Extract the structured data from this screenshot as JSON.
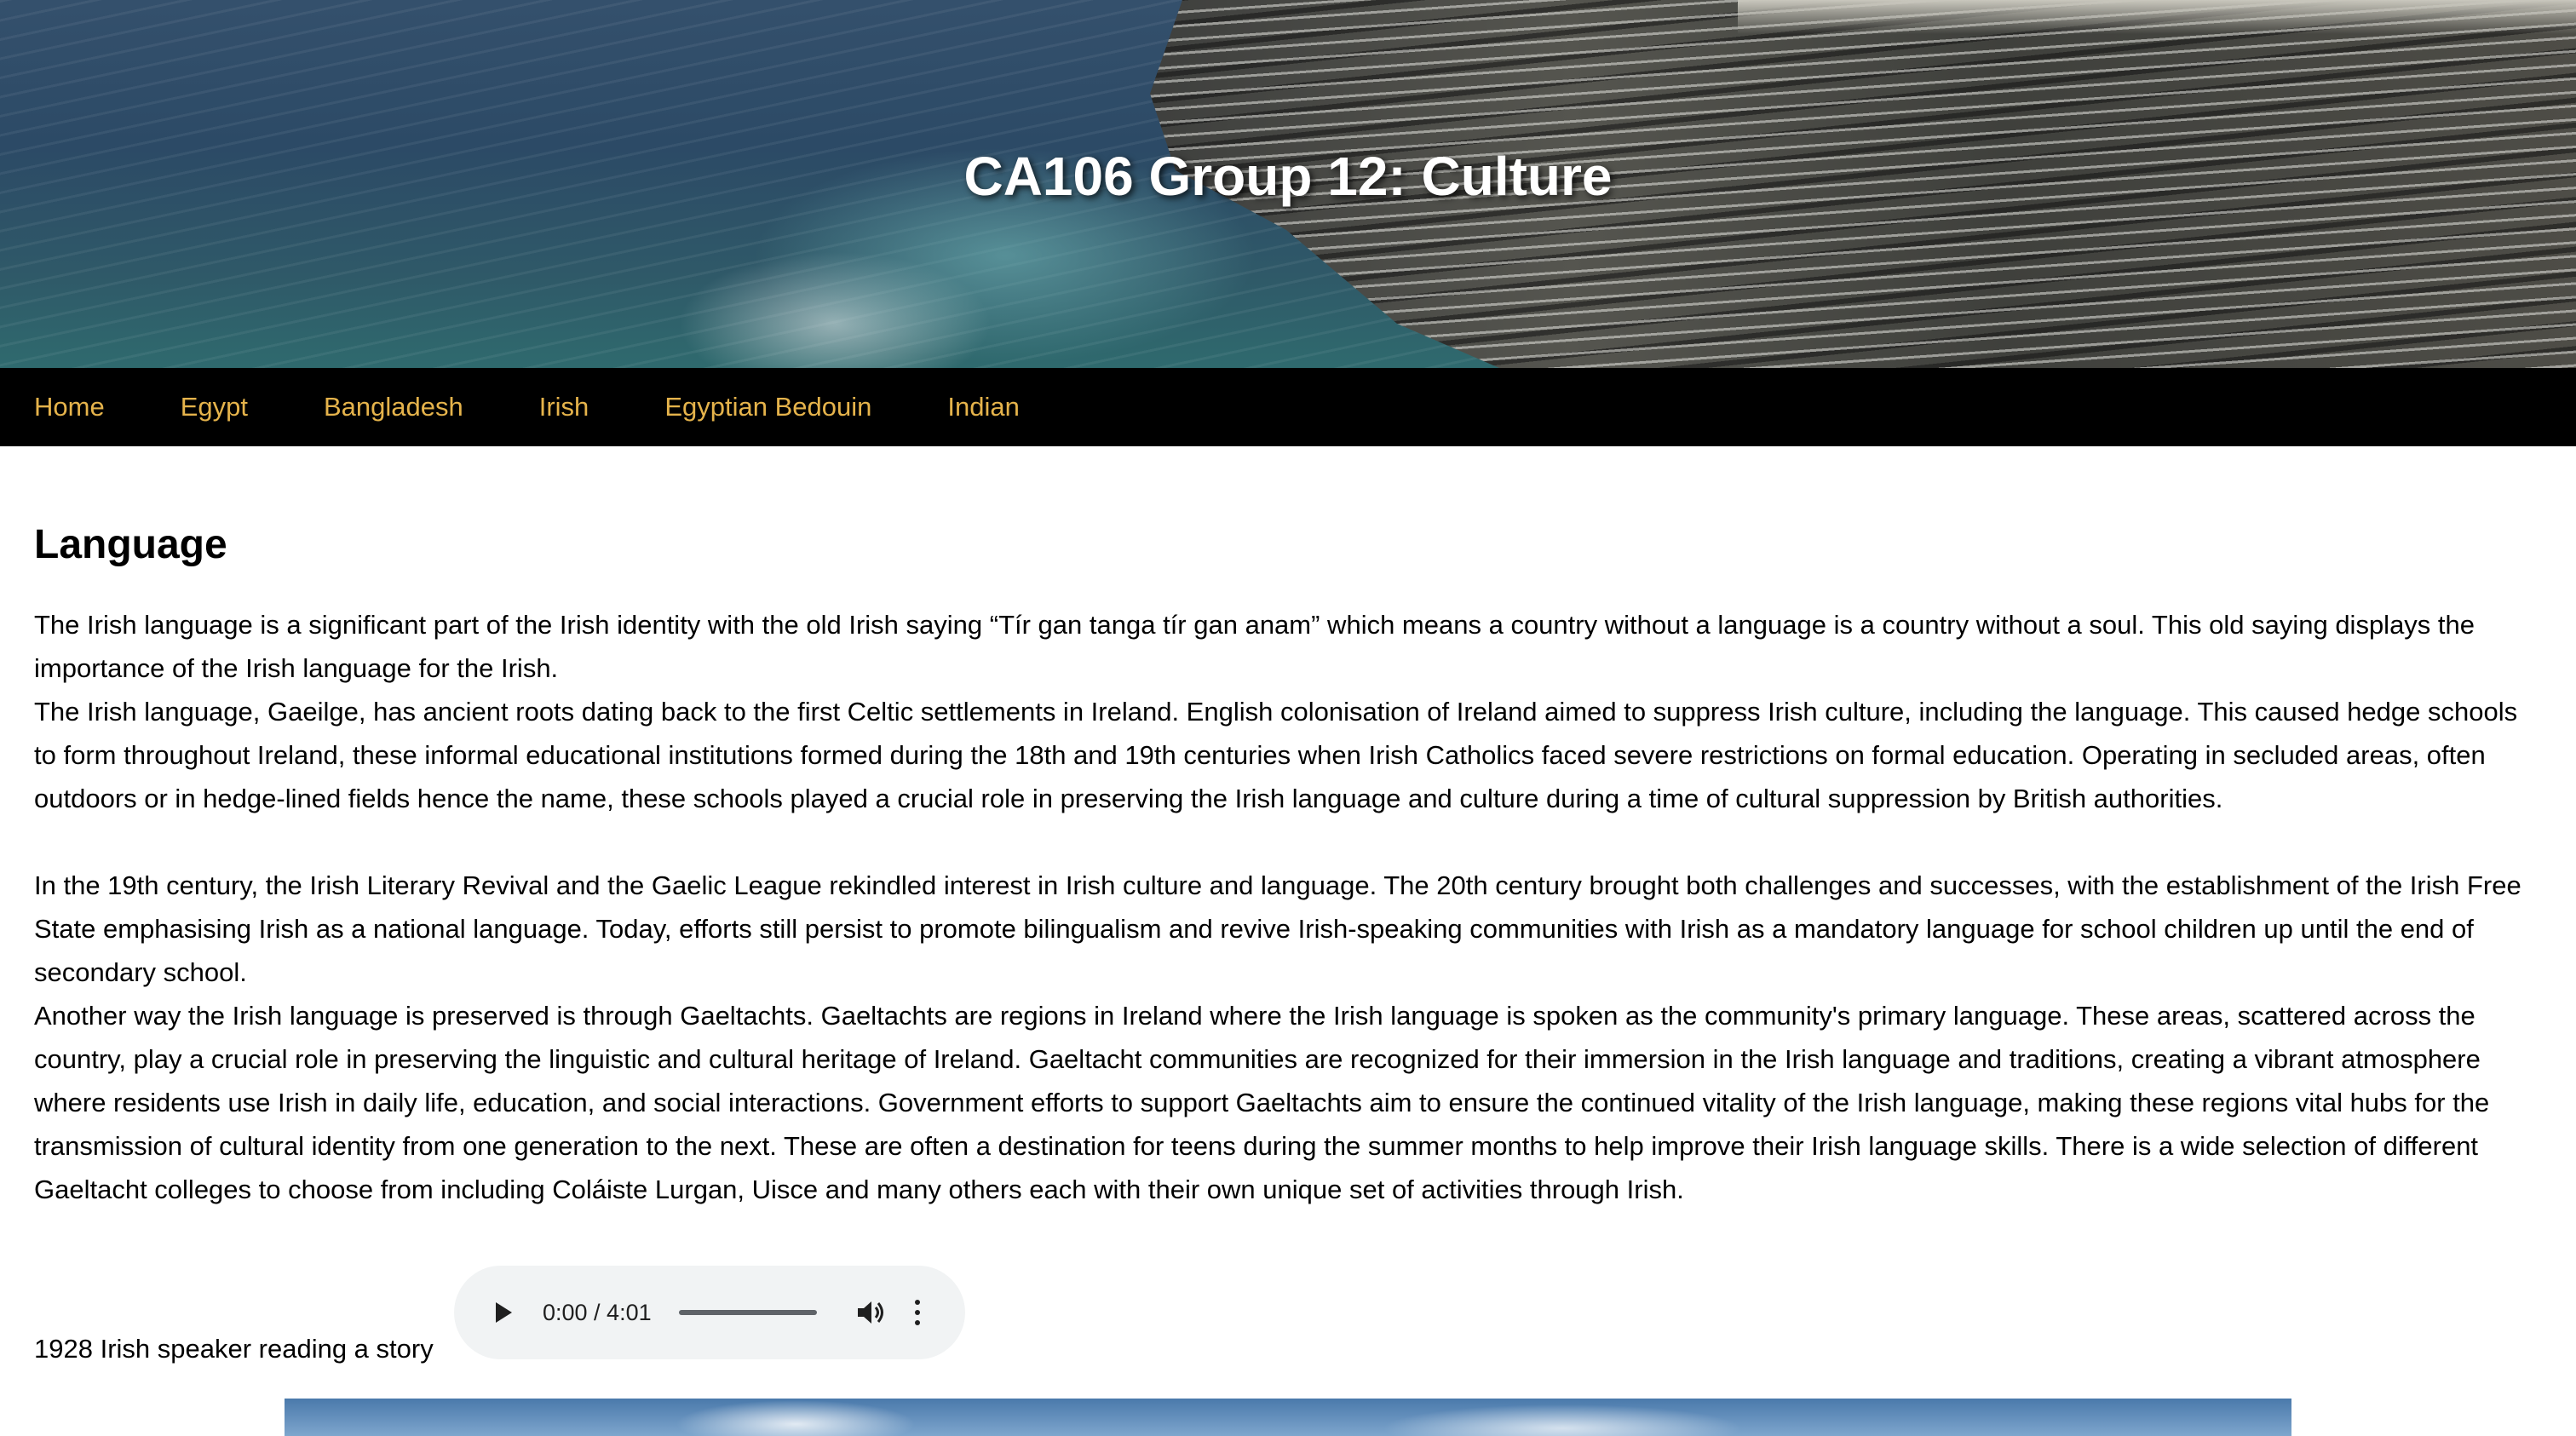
{
  "site": {
    "title": "CA106 Group 12: Culture"
  },
  "nav": {
    "items": [
      {
        "label": "Home"
      },
      {
        "label": "Egypt"
      },
      {
        "label": "Bangladesh"
      },
      {
        "label": "Irish"
      },
      {
        "label": "Egyptian Bedouin"
      },
      {
        "label": "Indian"
      }
    ],
    "link_color": "#e5b34b",
    "background": "#000000"
  },
  "section": {
    "heading": "Language",
    "paragraphs": [
      "The Irish language is a significant part of the Irish identity with the old Irish saying “Tír gan tanga tír gan anam” which means a country without a language is a country without a soul. This old saying displays the importance of the Irish language for the Irish.",
      "The Irish language, Gaeilge, has ancient roots dating back to the first Celtic settlements in Ireland. English colonisation of Ireland aimed to suppress Irish culture, including the language. This caused hedge schools to form throughout Ireland, these informal educational institutions formed during the 18th and 19th centuries when Irish Catholics faced severe restrictions on formal education. Operating in secluded areas, often outdoors or in hedge-lined fields hence the name, these schools played a crucial role in preserving the Irish language and culture during a time of cultural suppression by British authorities.",
      "In the 19th century, the Irish Literary Revival and the Gaelic League rekindled interest in Irish culture and language. The 20th century brought both challenges and successes, with the establishment of the Irish Free State emphasising Irish as a national language. Today, efforts still persist to promote bilingualism and revive Irish-speaking communities with Irish as a mandatory language for school children up until the end of secondary school.",
      "Another way the Irish language is preserved is through Gaeltachts. Gaeltachts are regions in Ireland where the Irish language is spoken as the community's primary language. These areas, scattered across the country, play a crucial role in preserving the linguistic and cultural heritage of Ireland. Gaeltacht communities are recognized for their immersion in the Irish language and traditions, creating a vibrant atmosphere where residents use Irish in daily life, education, and social interactions. Government efforts to support Gaeltachts aim to ensure the continued vitality of the Irish language, making these regions vital hubs for the transmission of cultural identity from one generation to the next. These are often a destination for teens during the summer months to help improve their Irish language skills. There is a wide selection of different Gaeltacht colleges to choose from including Coláiste Lurgan, Uisce and many others each with their own unique set of activities through Irish."
    ]
  },
  "audio": {
    "label": "1928 Irish speaker reading a story",
    "time": "0:00 / 4:01",
    "icons": {
      "play": "play-icon",
      "volume": "volume-icon",
      "more": "more-options-icon"
    }
  }
}
